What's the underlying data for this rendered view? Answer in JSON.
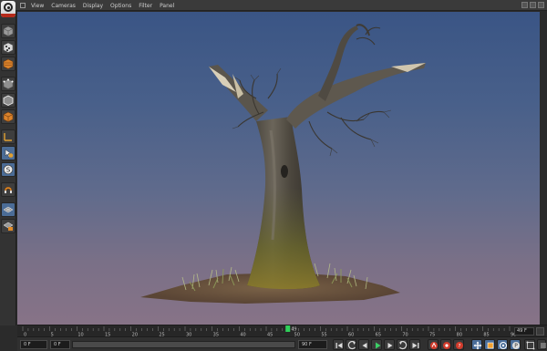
{
  "app": {
    "logo": "cinema4d-logo-icon"
  },
  "menu": {
    "items": [
      "View",
      "Cameras",
      "Display",
      "Options",
      "Filter",
      "Panel"
    ]
  },
  "toolbar": {
    "tools": [
      {
        "name": "undo-icon"
      },
      {
        "name": "model-mode-icon"
      },
      {
        "name": "texture-mode-icon"
      },
      {
        "name": "points-mode-icon"
      },
      {
        "name": "edges-mode-icon"
      },
      {
        "name": "polygons-mode-icon"
      },
      {
        "name": "axis-mode-icon"
      },
      {
        "name": "tweak-mode-icon"
      },
      {
        "name": "solo-icon"
      },
      {
        "name": "snap-icon"
      },
      {
        "name": "workplane-icon"
      },
      {
        "name": "lock-workplane-icon"
      }
    ]
  },
  "timeline": {
    "ticks": [
      "0",
      "5",
      "10",
      "15",
      "20",
      "25",
      "30",
      "35",
      "40",
      "45",
      "50",
      "55",
      "60",
      "65",
      "70",
      "75",
      "80",
      "85",
      "90"
    ],
    "current_frame": 49,
    "current_frame_label": "49",
    "end_frame_display": "49 F"
  },
  "transport": {
    "start_field": "0 F",
    "min_field": "0 F",
    "max_field": "90 F",
    "end_field": "90 F"
  },
  "colors": {
    "accent_blue": "#4a6d99",
    "playhead_green": "#2fd05a",
    "record_red": "#d23b2b"
  }
}
